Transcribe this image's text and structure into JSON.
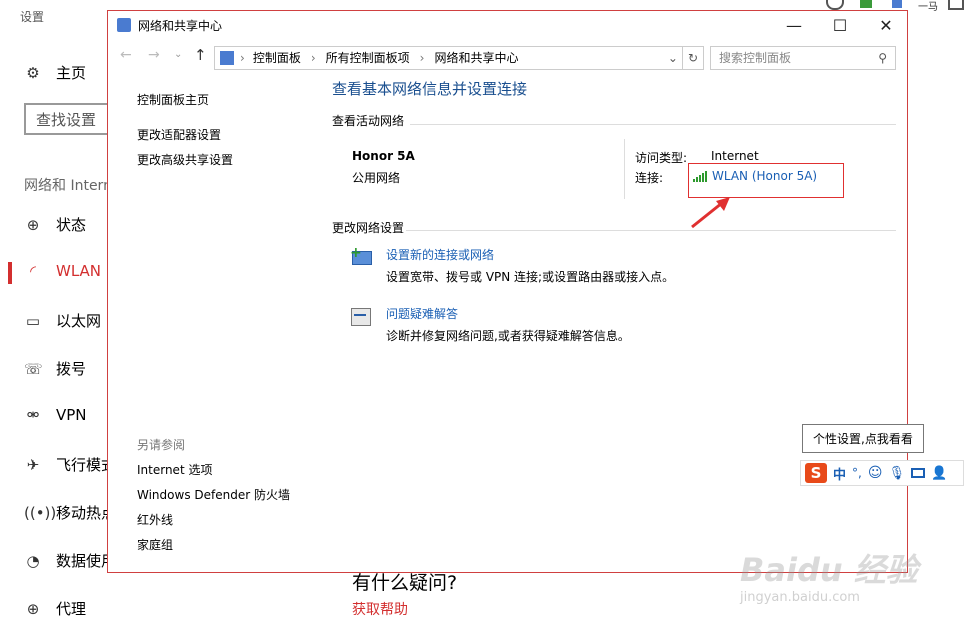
{
  "settings": {
    "title": "设置",
    "home": "主页",
    "search_placeholder": "查找设置",
    "section": "网络和 Intern",
    "nav": [
      {
        "label": "状态",
        "icon": "globe-icon"
      },
      {
        "label": "WLAN",
        "icon": "wifi-icon"
      },
      {
        "label": "以太网",
        "icon": "ethernet-icon"
      },
      {
        "label": "拨号",
        "icon": "dialup-icon"
      },
      {
        "label": "VPN",
        "icon": "vpn-icon"
      },
      {
        "label": "飞行模式",
        "icon": "airplane-icon"
      },
      {
        "label": "移动热点",
        "icon": "hotspot-icon"
      },
      {
        "label": "数据使用",
        "icon": "data-usage-icon"
      },
      {
        "label": "代理",
        "icon": "globe-icon"
      }
    ],
    "help_title": "有什么疑问?",
    "help_link": "获取帮助",
    "accent": "#d32f2f"
  },
  "window": {
    "title": "网络和共享中心",
    "breadcrumb": [
      "控制面板",
      "所有控制面板项",
      "网络和共享中心"
    ],
    "search_placeholder": "搜索控制面板",
    "sidebar_links": [
      "控制面板主页",
      "更改适配器设置",
      "更改高级共享设置"
    ],
    "see_also_title": "另请参阅",
    "see_also": [
      "Internet 选项",
      "Windows Defender 防火墙",
      "红外线",
      "家庭组"
    ],
    "main_heading": "查看基本网络信息并设置连接",
    "active_title": "查看活动网络",
    "network_name": "Honor 5A",
    "network_type": "公用网络",
    "access_label": "访问类型:",
    "access_value": "Internet",
    "conn_label": "连接:",
    "conn_value": "WLAN (Honor 5A)",
    "change_title": "更改网络设置",
    "tasks": [
      {
        "title": "设置新的连接或网络",
        "desc": "设置宽带、拨号或 VPN 连接;或设置路由器或接入点。",
        "icon": "new-connection-icon"
      },
      {
        "title": "问题疑难解答",
        "desc": "诊断并修复网络问题,或者获得疑难解答信息。",
        "icon": "troubleshoot-icon"
      }
    ]
  },
  "ime": {
    "tooltip": "个性设置,点我看看",
    "lang": "中",
    "punct": "°,"
  },
  "watermark": {
    "text": "Baidu 经验",
    "url": "jingyan.baidu.com"
  },
  "top_right": {
    "text": "一马"
  }
}
